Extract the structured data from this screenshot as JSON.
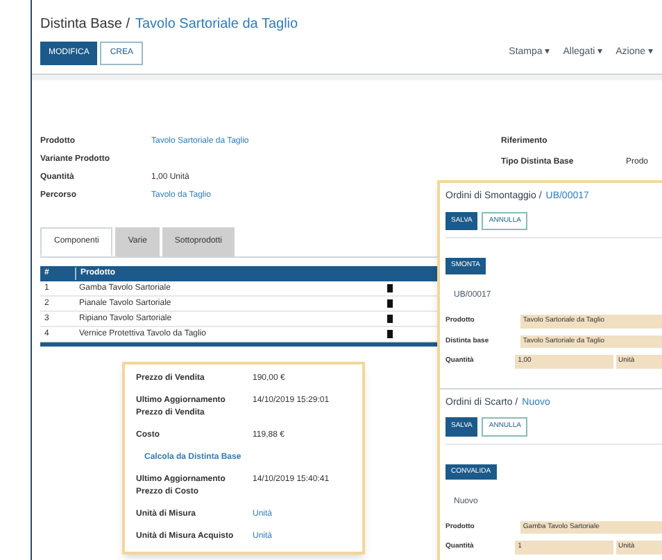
{
  "breadcrumb": {
    "parent": "Distinta Base /",
    "current": "Tavolo Sartoriale da Taglio"
  },
  "buttons": [
    {
      "label": "MODIFICA",
      "primary": true
    },
    {
      "label": "CREA",
      "primary": false
    }
  ],
  "menus": [
    "Stampa ▾",
    "Allegati ▾",
    "Azione ▾"
  ],
  "fields": [
    {
      "label": "Prodotto",
      "value": "Tavolo Sartoriale da Taglio",
      "link": true
    },
    {
      "label": "Variante Prodotto"
    },
    {
      "label": "Quantità",
      "value": "1,00 Unità",
      "link": false
    },
    {
      "label": "Percorso",
      "value": "Tavolo da Taglio",
      "link": true
    }
  ],
  "right_fields": [
    {
      "label": "Riferimento"
    },
    {
      "label": "Tipo Distinta Base",
      "value": "Prodo"
    }
  ],
  "tabs": [
    {
      "label": "Componenti",
      "selected": true
    },
    {
      "label": "Varie",
      "selected": false
    },
    {
      "label": "Sottoprodotti",
      "selected": false
    }
  ],
  "table": {
    "columns": [
      "#",
      "Prodotto"
    ],
    "rows": [
      {
        "cells": [
          "1",
          "Gamba Tavolo Sartoriale"
        ]
      },
      {
        "cells": [
          "2",
          "Pianale Tavolo Sartoriale"
        ]
      },
      {
        "cells": [
          "3",
          "Ripiano Tavolo Sartoriale"
        ]
      },
      {
        "cells": [
          "4",
          "Vernice Protettiva Tavolo da Taglio"
        ]
      }
    ]
  },
  "popover": {
    "rows": [
      {
        "kind": "pair",
        "label": "Prezzo di Vendita",
        "value": "190,00 €",
        "link": false
      },
      {
        "kind": "pair",
        "label": "Ultimo Aggiornamento Prezzo di Vendita",
        "value": "14/10/2019 15:29:01",
        "link": false
      },
      {
        "kind": "pair",
        "label": "Costo",
        "value": "119,88 €",
        "link": false
      },
      {
        "kind": "action",
        "label": "Calcola da Distinta Base"
      },
      {
        "kind": "pair",
        "label": "Ultimo Aggiornamento Prezzo di Costo",
        "value": "14/10/2019 15:40:41",
        "link": false
      },
      {
        "kind": "pair",
        "label": "Unità di Misura",
        "value": "Unità",
        "link": true
      },
      {
        "kind": "pair",
        "label": "Unità di Misura Acquisto",
        "value": "Unità",
        "link": true
      }
    ]
  },
  "panels": [
    {
      "title": "Ordini di Smontaggio /",
      "title_link": "UB/00017",
      "buttons": [
        "SALVA",
        "ANNULLA"
      ],
      "action": "SMONTA",
      "heading": "UB/00017",
      "fields": [
        {
          "label": "Prodotto",
          "value": "Tavolo Sartoriale da Taglio"
        },
        {
          "label": "Distinta base",
          "value": "Tavolo Sartoriale da Taglio"
        },
        {
          "label": "Quantità",
          "value": "1,00",
          "unit": "Unità"
        }
      ]
    },
    {
      "title": "Ordini di Scarto /",
      "title_link": "Nuovo",
      "buttons": [
        "SALVA",
        "ANNULLA"
      ],
      "action": "CONVALIDA",
      "heading": "Nuovo",
      "fields": [
        {
          "label": "Prodotto",
          "value": "Gamba Tavolo Sartoriale"
        },
        {
          "label": "Quantità",
          "value": "1",
          "unit": "Unità"
        }
      ]
    }
  ]
}
